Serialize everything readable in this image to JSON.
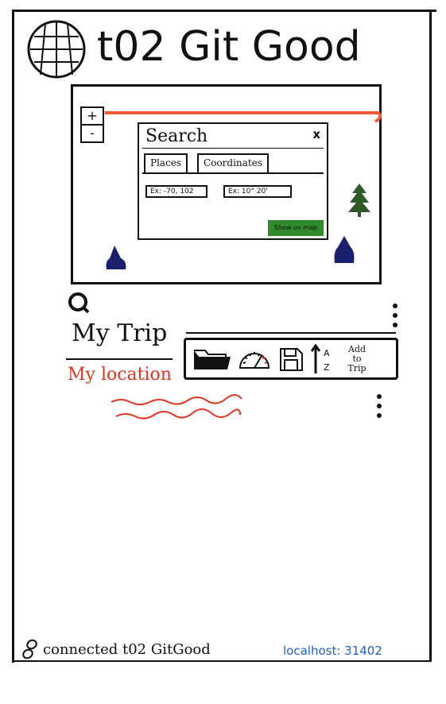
{
  "app": {
    "title": "t02 Git Good",
    "logo_icon": "globe-icon"
  },
  "map": {
    "zoom_in_label": "+",
    "zoom_out_label": "-",
    "route_color": "#f05a3a",
    "marker_color": "#1a1f6e",
    "tree_color": "#2e5a2a",
    "search": {
      "title": "Search",
      "close_label": "x",
      "tabs": [
        {
          "label": "Places"
        },
        {
          "label": "Coordinates"
        }
      ],
      "place_input_placeholder": "Ex: -70, 102",
      "coordinate_input_placeholder": "Ex: 10° 20'",
      "show_button_label": "Show on map",
      "show_button_color": "#2f8a2b"
    }
  },
  "trip": {
    "title": "My Trip",
    "location_label": "My location",
    "location_color": "#e53322"
  },
  "toolbar": {
    "items": [
      {
        "icon": "folder-icon"
      },
      {
        "icon": "speedometer-icon"
      },
      {
        "icon": "save-icon"
      },
      {
        "icon": "sort-az-icon",
        "sort_from": "A",
        "sort_to": "Z"
      }
    ],
    "add_to_trip_label": [
      "Add",
      "to",
      "Trip"
    ]
  },
  "footer": {
    "connection_icon": "link-icon",
    "connection_text": "connected t02 GitGood",
    "server_text": "localhost: 31402",
    "server_color": "#1f5fd6"
  }
}
